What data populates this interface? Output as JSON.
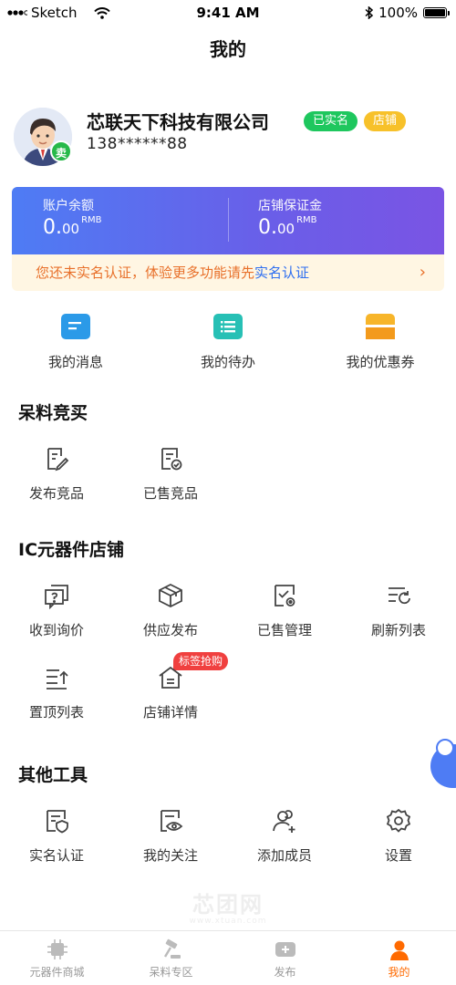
{
  "status_bar": {
    "carrier": "Sketch",
    "time": "9:41 AM",
    "battery": "100%"
  },
  "nav": {
    "title": "我的"
  },
  "profile": {
    "company": "芯联天下科技有限公司",
    "phone": "138******88",
    "verified_tag": "已实名",
    "shop_tag": "店铺",
    "seller_badge": "卖"
  },
  "balance": {
    "account_label": "账户余额",
    "account_int": "0.",
    "account_dec": "00",
    "account_unit": "RMB",
    "deposit_label": "店铺保证金",
    "deposit_int": "0.",
    "deposit_dec": "00",
    "deposit_unit": "RMB"
  },
  "verify_banner": {
    "text": "您还未实名认证，体验更多功能请先",
    "link": "实名认证",
    "chevron": "›"
  },
  "quick": [
    {
      "label": "我的消息",
      "icon": "message-icon",
      "color": "#2b9ae8"
    },
    {
      "label": "我的待办",
      "icon": "todo-list-icon",
      "color": "#27c0b5"
    },
    {
      "label": "我的优惠券",
      "icon": "coupon-icon",
      "color": "#f7b52a"
    }
  ],
  "sections": {
    "bidding": {
      "title": "呆料竞买",
      "items": [
        {
          "label": "发布竞品",
          "icon": "edit-document-icon"
        },
        {
          "label": "已售竞品",
          "icon": "sold-document-icon"
        }
      ]
    },
    "ic_shop": {
      "title": "IC元器件店铺",
      "items": [
        {
          "label": "收到询价",
          "icon": "inquiry-icon"
        },
        {
          "label": "供应发布",
          "icon": "box-icon"
        },
        {
          "label": "已售管理",
          "icon": "sold-manage-icon"
        },
        {
          "label": "刷新列表",
          "icon": "refresh-list-icon"
        },
        {
          "label": "置顶列表",
          "icon": "pin-top-list-icon"
        },
        {
          "label": "店铺详情",
          "icon": "shop-icon"
        }
      ],
      "promo_badge": "标签抢购"
    },
    "tools": {
      "title": "其他工具",
      "items": [
        {
          "label": "实名认证",
          "icon": "verify-id-icon"
        },
        {
          "label": "我的关注",
          "icon": "follow-eye-icon"
        },
        {
          "label": "添加成员",
          "icon": "add-member-icon"
        },
        {
          "label": "设置",
          "icon": "gear-icon"
        }
      ]
    }
  },
  "watermark": {
    "text": "芯团网",
    "sub": "www.xtuan.com"
  },
  "tabbar": [
    {
      "label": "元器件商城",
      "icon": "chip-icon",
      "active": false
    },
    {
      "label": "呆料专区",
      "icon": "gavel-icon",
      "active": false
    },
    {
      "label": "发布",
      "icon": "plus-icon",
      "active": false
    },
    {
      "label": "我的",
      "icon": "user-icon",
      "active": true
    }
  ],
  "colors": {
    "accent": "#ff6a00",
    "card_start": "#4e7cf4",
    "card_end": "#7a54e4",
    "verified": "#1ec75e",
    "shop": "#f7c12a",
    "promo": "#f0403f"
  }
}
